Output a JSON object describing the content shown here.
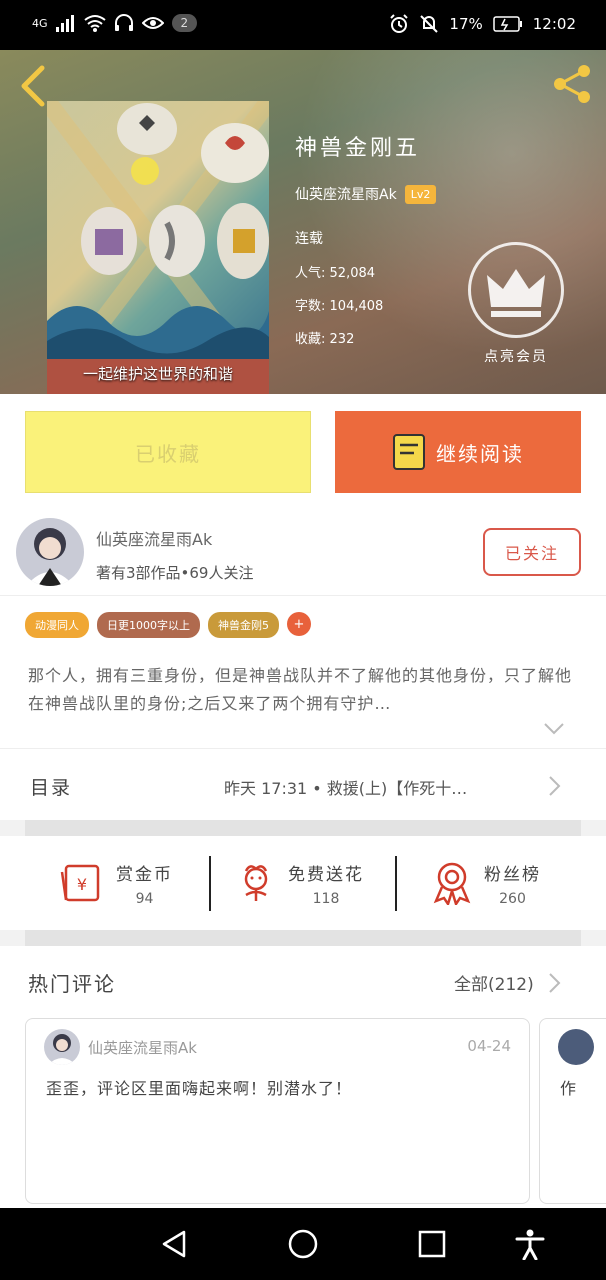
{
  "status_bar": {
    "network": "4G",
    "notification_count": "2",
    "battery": "17%",
    "time": "12:02"
  },
  "book": {
    "title": "神兽金刚五",
    "author": "仙英座流星雨Ak",
    "author_level": "Lv2",
    "status": "连载",
    "stats": [
      {
        "label": "人气:",
        "value": "52,084"
      },
      {
        "label": "字数:",
        "value": "104,408"
      },
      {
        "label": "收藏:",
        "value": "232"
      }
    ],
    "cover_caption": "一起维护这世界的和谐",
    "vip_label": "点亮会员"
  },
  "actions": {
    "collected_label": "已收藏",
    "read_label": "继续阅读"
  },
  "author_card": {
    "name": "仙英座流星雨Ak",
    "meta": "著有3部作品•69人关注",
    "follow_label": "已关注"
  },
  "tags": [
    {
      "label": "动漫同人",
      "color": "#f0a734"
    },
    {
      "label": "日更1000字以上",
      "color": "#b06a4e"
    },
    {
      "label": "神兽金刚5",
      "color": "#c99a3a"
    }
  ],
  "tag_add": "+",
  "intro": "那个人，拥有三重身份，但是神兽战队并不了解他的其他身份，只了解他在神兽战队里的身份;之后又来了两个拥有守护…",
  "catalog": {
    "label": "目录",
    "latest": "昨天  17:31 • 救援(上)【作死十…"
  },
  "rewards": [
    {
      "label": "赏金币",
      "value": "94",
      "icon": "coin-icon"
    },
    {
      "label": "免费送花",
      "value": "118",
      "icon": "flower-icon"
    },
    {
      "label": "粉丝榜",
      "value": "260",
      "icon": "ribbon-icon"
    }
  ],
  "comments": {
    "title": "热门评论",
    "all_label": "全部(212)",
    "items": [
      {
        "name": "仙英座流星雨Ak",
        "date": "04-24",
        "text": "歪歪，评论区里面嗨起来啊！别潜水了！"
      },
      {
        "text": "作"
      }
    ]
  },
  "colors": {
    "accent": "#ec6a3d",
    "collected_bg": "#faf27a",
    "follow": "#d9584a"
  }
}
